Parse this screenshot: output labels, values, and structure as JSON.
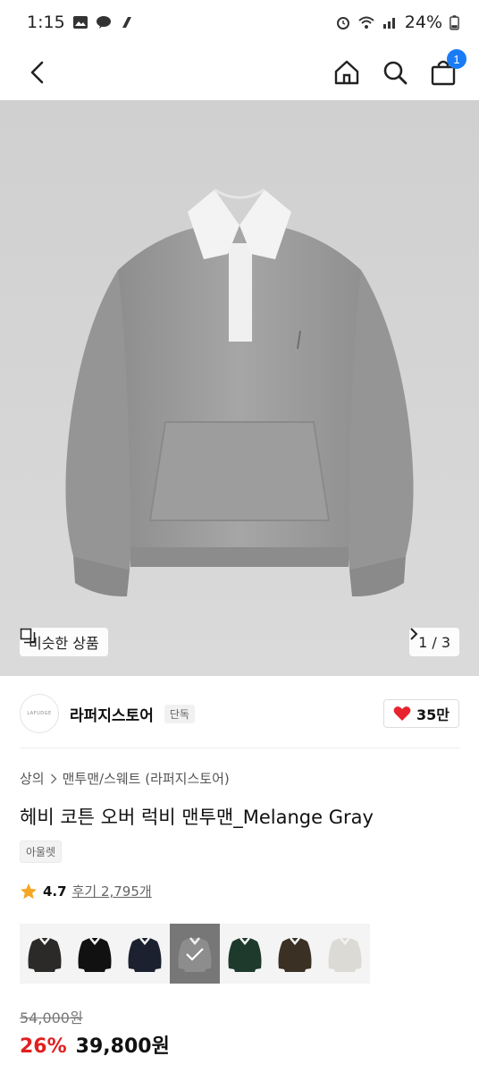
{
  "status_bar": {
    "time": "1:15",
    "battery": "24%"
  },
  "header": {
    "cart_count": "1"
  },
  "gallery": {
    "similar_label": "비슷한 상품",
    "page_indicator": "1 / 3"
  },
  "store": {
    "logo_text": "LAFUDGE",
    "name": "라퍼지스토어",
    "badge": "단독",
    "likes": "35만"
  },
  "product": {
    "breadcrumb": [
      "상의",
      "맨투맨/스웨트 (라퍼지스토어)"
    ],
    "title": "헤비 코튼 오버 럭비 맨투맨_Melange Gray",
    "tag": "아울렛",
    "rating": "4.7",
    "review_label": "후기 2,795개",
    "original_price": "54,000원",
    "discount": "26%",
    "price": "39,800원"
  },
  "swatches": [
    {
      "color": "#2b2a28",
      "name": "charcoal-black"
    },
    {
      "color": "#111111",
      "name": "black"
    },
    {
      "color": "#1c2130",
      "name": "navy"
    },
    {
      "color": "#8d8d8d",
      "name": "melange-gray",
      "selected": true
    },
    {
      "color": "#1e3a2c",
      "name": "green"
    },
    {
      "color": "#3a3024",
      "name": "brown"
    },
    {
      "color": "#dcdad4",
      "name": "ivory"
    }
  ],
  "colors": {
    "accent_red": "#e02020",
    "badge_blue": "#1a7cf5",
    "heart_red": "#e8232d"
  }
}
